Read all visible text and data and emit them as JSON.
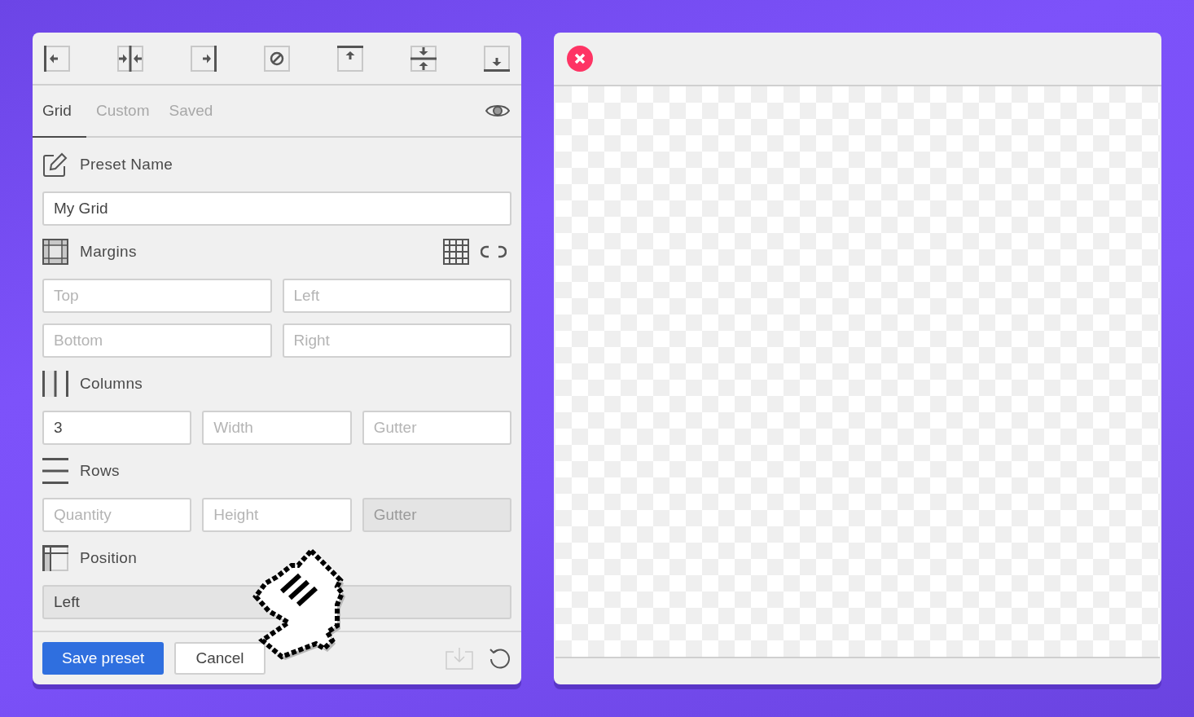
{
  "toolbar": [
    {
      "kind": "align-left"
    },
    {
      "kind": "align-center"
    },
    {
      "kind": "align-right"
    },
    {
      "kind": "none"
    },
    {
      "kind": "align-top"
    },
    {
      "kind": "align-middle"
    },
    {
      "kind": "align-bottom"
    }
  ],
  "tabs": [
    {
      "label": "Grid",
      "selected": true
    },
    {
      "label": "Custom",
      "selected": false
    },
    {
      "label": "Saved",
      "selected": false
    }
  ],
  "sections": [
    {
      "kind": "preset",
      "title": "Preset Name",
      "fields": [
        {
          "value": "My Grid",
          "disabled": false
        }
      ]
    },
    {
      "kind": "margins",
      "title": "Margins",
      "fields": [
        {
          "placeholder": "Top",
          "disabled": false
        },
        {
          "placeholder": "Left",
          "disabled": false
        },
        {
          "placeholder": "Bottom",
          "disabled": false
        },
        {
          "placeholder": "Right",
          "disabled": false
        }
      ]
    },
    {
      "kind": "columns",
      "title": "Columns",
      "fields": [
        {
          "value": "3",
          "disabled": false
        },
        {
          "placeholder": "Width",
          "disabled": false
        },
        {
          "placeholder": "Gutter",
          "disabled": false
        }
      ]
    },
    {
      "kind": "rows",
      "title": "Rows",
      "fields": [
        {
          "placeholder": "Quantity",
          "disabled": false
        },
        {
          "placeholder": "Height",
          "disabled": false
        },
        {
          "placeholder": "Gutter",
          "disabled": true
        }
      ]
    },
    {
      "kind": "position",
      "title": "Position",
      "fields": [
        {
          "value": "Left",
          "disabled": true
        }
      ]
    }
  ],
  "footer": {
    "primary": "Save preset",
    "secondary": "Cancel",
    "download_disabled": true
  }
}
